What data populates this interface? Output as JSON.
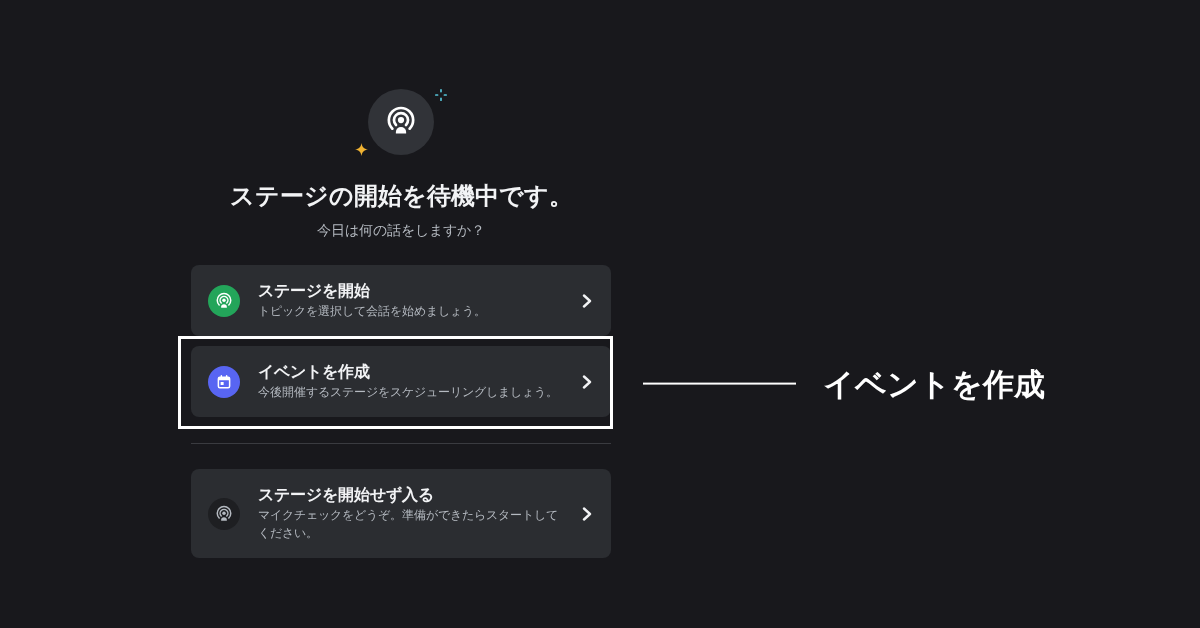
{
  "hero": {
    "title": "ステージの開始を待機中です。",
    "subtitle": "今日は何の話をしますか？"
  },
  "options": [
    {
      "kind": "start",
      "title": "ステージを開始",
      "description": "トピックを選択して会話を始めましょう。",
      "highlighted": false
    },
    {
      "kind": "event",
      "title": "イベントを作成",
      "description": "今後開催するステージをスケジューリングしましょう。",
      "highlighted": true
    }
  ],
  "secondary_options": [
    {
      "kind": "listen",
      "title": "ステージを開始せず入る",
      "description": "マイクチェックをどうぞ。準備ができたらスタートしてください。",
      "highlighted": false
    }
  ],
  "annotation": {
    "label": "イベントを作成"
  }
}
